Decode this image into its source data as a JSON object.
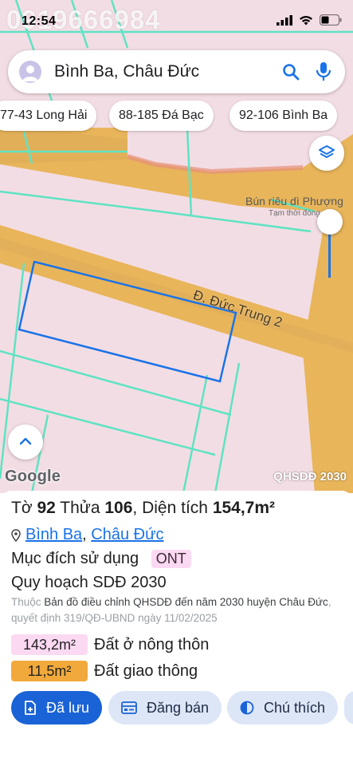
{
  "status_bar": {
    "time": "12:54",
    "watermark_phone": "0919666984"
  },
  "search": {
    "query": "Bình Ba, Châu Đức",
    "search_icon": "search-icon",
    "mic_icon": "microphone-icon",
    "avatar_icon": "profile-avatar-icon"
  },
  "chips": [
    {
      "label": "77-43 Long Hải"
    },
    {
      "label": "88-185 Đá Bạc"
    },
    {
      "label": "92-106 Bình Ba"
    }
  ],
  "map": {
    "poi_name": "Bún riêu dì Phượng",
    "poi_status": "Tạm thời đóng cửa",
    "road_label": "Đ. Đức Trung 2",
    "attribution": "Google",
    "layer_label": "QHSDĐ 2030",
    "colors": {
      "residential": "#f3dde4",
      "road": "#e8b55a",
      "highlight_border": "#1a73e8",
      "parcel_line": "#5fe3c3"
    }
  },
  "sheet": {
    "to_label": "Tờ",
    "to_value": "92",
    "thua_label": "Thửa",
    "thua_value": "106",
    "dien_tich_label": "Diện tích",
    "dien_tich_value": "154,7m²",
    "location_ward": "Bình Ba",
    "location_district": "Châu Đức",
    "location_separator": ",",
    "purpose_label": "Mục đích sử dụng",
    "purpose_code": "ONT",
    "plan_label": "Quy hoạch SDĐ 2030",
    "desc_prefix": "Thuộc",
    "desc_main": "Bản đồ điều chỉnh QHSDĐ đến năm 2030 huyện Châu Đức",
    "desc_suffix": ", quyết định 319/QĐ-UBND ngày 11/02/2025",
    "areas": [
      {
        "value": "143,2m²",
        "label": "Đất ở nông thôn",
        "color": "#fcd9f2"
      },
      {
        "value": "11,5m²",
        "label": "Đất giao thông",
        "color": "#f2a93b"
      }
    ],
    "actions": {
      "saved": "Đã lưu",
      "sell": "Đăng bán",
      "legend": "Chú thích"
    }
  }
}
